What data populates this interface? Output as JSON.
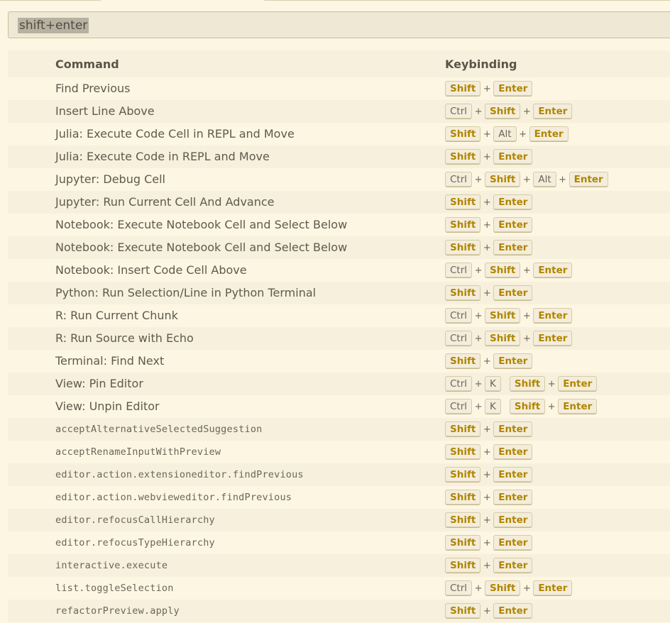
{
  "search": {
    "value": "shift+enter"
  },
  "table": {
    "headers": {
      "command": "Command",
      "keybinding": "Keybinding"
    },
    "rows": [
      {
        "command": "Find Previous",
        "mono": false,
        "chords": [
          [
            {
              "k": "Shift",
              "h": true
            },
            {
              "k": "Enter",
              "h": true
            }
          ]
        ]
      },
      {
        "command": "Insert Line Above",
        "mono": false,
        "chords": [
          [
            {
              "k": "Ctrl",
              "h": false
            },
            {
              "k": "Shift",
              "h": true
            },
            {
              "k": "Enter",
              "h": true
            }
          ]
        ]
      },
      {
        "command": "Julia: Execute Code Cell in REPL and Move",
        "mono": false,
        "chords": [
          [
            {
              "k": "Shift",
              "h": true
            },
            {
              "k": "Alt",
              "h": false
            },
            {
              "k": "Enter",
              "h": true
            }
          ]
        ]
      },
      {
        "command": "Julia: Execute Code in REPL and Move",
        "mono": false,
        "chords": [
          [
            {
              "k": "Shift",
              "h": true
            },
            {
              "k": "Enter",
              "h": true
            }
          ]
        ]
      },
      {
        "command": "Jupyter: Debug Cell",
        "mono": false,
        "chords": [
          [
            {
              "k": "Ctrl",
              "h": false
            },
            {
              "k": "Shift",
              "h": true
            },
            {
              "k": "Alt",
              "h": false
            },
            {
              "k": "Enter",
              "h": true
            }
          ]
        ]
      },
      {
        "command": "Jupyter: Run Current Cell And Advance",
        "mono": false,
        "chords": [
          [
            {
              "k": "Shift",
              "h": true
            },
            {
              "k": "Enter",
              "h": true
            }
          ]
        ]
      },
      {
        "command": "Notebook: Execute Notebook Cell and Select Below",
        "mono": false,
        "chords": [
          [
            {
              "k": "Shift",
              "h": true
            },
            {
              "k": "Enter",
              "h": true
            }
          ]
        ]
      },
      {
        "command": "Notebook: Execute Notebook Cell and Select Below",
        "mono": false,
        "chords": [
          [
            {
              "k": "Shift",
              "h": true
            },
            {
              "k": "Enter",
              "h": true
            }
          ]
        ]
      },
      {
        "command": "Notebook: Insert Code Cell Above",
        "mono": false,
        "chords": [
          [
            {
              "k": "Ctrl",
              "h": false
            },
            {
              "k": "Shift",
              "h": true
            },
            {
              "k": "Enter",
              "h": true
            }
          ]
        ]
      },
      {
        "command": "Python: Run Selection/Line in Python Terminal",
        "mono": false,
        "chords": [
          [
            {
              "k": "Shift",
              "h": true
            },
            {
              "k": "Enter",
              "h": true
            }
          ]
        ]
      },
      {
        "command": "R: Run Current Chunk",
        "mono": false,
        "chords": [
          [
            {
              "k": "Ctrl",
              "h": false
            },
            {
              "k": "Shift",
              "h": true
            },
            {
              "k": "Enter",
              "h": true
            }
          ]
        ]
      },
      {
        "command": "R: Run Source with Echo",
        "mono": false,
        "chords": [
          [
            {
              "k": "Ctrl",
              "h": false
            },
            {
              "k": "Shift",
              "h": true
            },
            {
              "k": "Enter",
              "h": true
            }
          ]
        ]
      },
      {
        "command": "Terminal: Find Next",
        "mono": false,
        "chords": [
          [
            {
              "k": "Shift",
              "h": true
            },
            {
              "k": "Enter",
              "h": true
            }
          ]
        ]
      },
      {
        "command": "View: Pin Editor",
        "mono": false,
        "chords": [
          [
            {
              "k": "Ctrl",
              "h": false
            },
            {
              "k": "K",
              "h": false
            }
          ],
          [
            {
              "k": "Shift",
              "h": true
            },
            {
              "k": "Enter",
              "h": true
            }
          ]
        ]
      },
      {
        "command": "View: Unpin Editor",
        "mono": false,
        "chords": [
          [
            {
              "k": "Ctrl",
              "h": false
            },
            {
              "k": "K",
              "h": false
            }
          ],
          [
            {
              "k": "Shift",
              "h": true
            },
            {
              "k": "Enter",
              "h": true
            }
          ]
        ]
      },
      {
        "command": "acceptAlternativeSelectedSuggestion",
        "mono": true,
        "chords": [
          [
            {
              "k": "Shift",
              "h": true
            },
            {
              "k": "Enter",
              "h": true
            }
          ]
        ]
      },
      {
        "command": "acceptRenameInputWithPreview",
        "mono": true,
        "chords": [
          [
            {
              "k": "Shift",
              "h": true
            },
            {
              "k": "Enter",
              "h": true
            }
          ]
        ]
      },
      {
        "command": "editor.action.extensioneditor.findPrevious",
        "mono": true,
        "chords": [
          [
            {
              "k": "Shift",
              "h": true
            },
            {
              "k": "Enter",
              "h": true
            }
          ]
        ]
      },
      {
        "command": "editor.action.webvieweditor.findPrevious",
        "mono": true,
        "chords": [
          [
            {
              "k": "Shift",
              "h": true
            },
            {
              "k": "Enter",
              "h": true
            }
          ]
        ]
      },
      {
        "command": "editor.refocusCallHierarchy",
        "mono": true,
        "chords": [
          [
            {
              "k": "Shift",
              "h": true
            },
            {
              "k": "Enter",
              "h": true
            }
          ]
        ]
      },
      {
        "command": "editor.refocusTypeHierarchy",
        "mono": true,
        "chords": [
          [
            {
              "k": "Shift",
              "h": true
            },
            {
              "k": "Enter",
              "h": true
            }
          ]
        ]
      },
      {
        "command": "interactive.execute",
        "mono": true,
        "chords": [
          [
            {
              "k": "Shift",
              "h": true
            },
            {
              "k": "Enter",
              "h": true
            }
          ]
        ]
      },
      {
        "command": "list.toggleSelection",
        "mono": true,
        "chords": [
          [
            {
              "k": "Ctrl",
              "h": false
            },
            {
              "k": "Shift",
              "h": true
            },
            {
              "k": "Enter",
              "h": true
            }
          ]
        ]
      },
      {
        "command": "refactorPreview.apply",
        "mono": true,
        "chords": [
          [
            {
              "k": "Shift",
              "h": true
            },
            {
              "k": "Enter",
              "h": true
            }
          ]
        ]
      }
    ]
  },
  "colors": {
    "background": "#fdf6e3",
    "row_alt": "#f6f0dc",
    "highlight_key": "#b08500",
    "search_bg": "#eee8d5",
    "selection": "#b7b1a1"
  }
}
